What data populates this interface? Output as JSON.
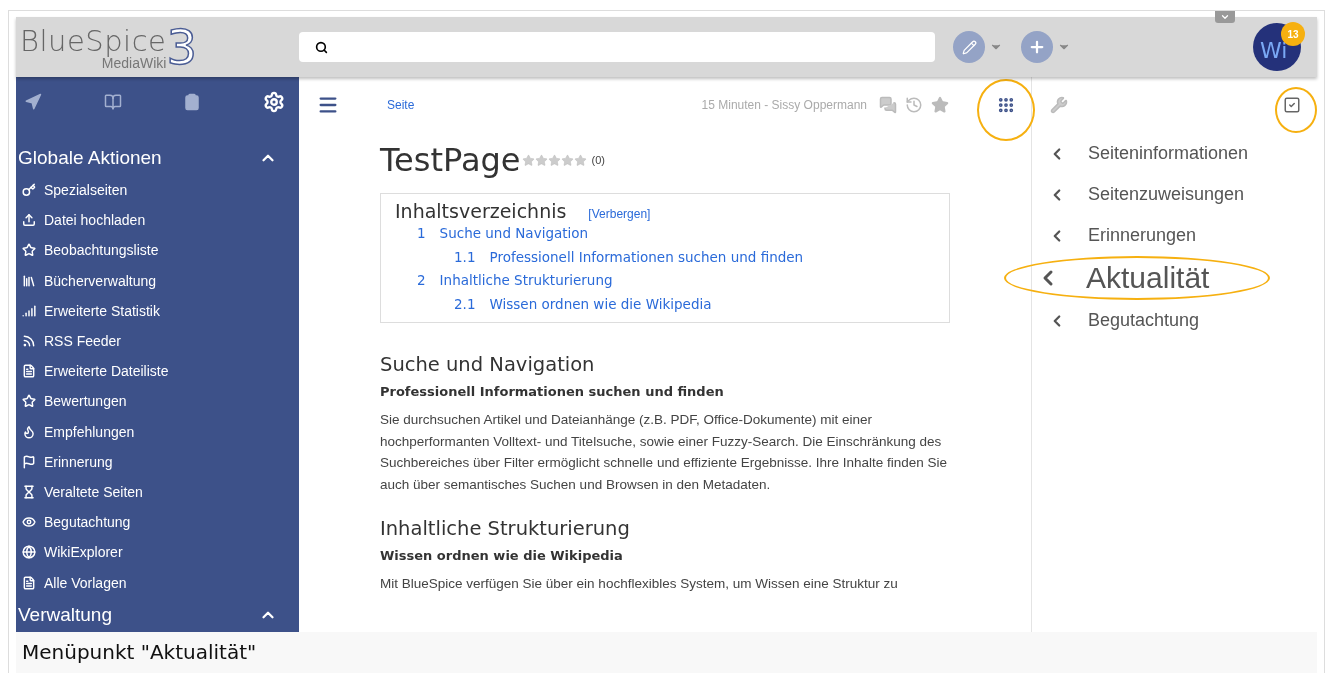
{
  "header": {
    "logo": {
      "name": "BlueSpice",
      "sub": "MediaWiki",
      "version": "3"
    },
    "avatar": {
      "initials": "Wi",
      "badge": "13"
    }
  },
  "sidebar": {
    "section": {
      "title": "Globale Aktionen",
      "expanded": true
    },
    "items": [
      "Spezialseiten",
      "Datei hochladen",
      "Beobachtungsliste",
      "Bücherverwaltung",
      "Erweiterte Statistik",
      "RSS Feeder",
      "Erweiterte Dateiliste",
      "Bewertungen",
      "Empfehlungen",
      "Erinnerung",
      "Veraltete Seiten",
      "Begutachtung",
      "WikiExplorer",
      "Alle Vorlagen"
    ],
    "next_section": {
      "title": "Verwaltung",
      "expanded": true
    }
  },
  "page": {
    "breadcrumb": "Seite",
    "last_edit": "15 Minuten - Sissy Oppermann",
    "title": "TestPage",
    "rating": {
      "stars": 0,
      "count": "(0)"
    },
    "toc": {
      "title": "Inhaltsverzeichnis",
      "toggle": "[Verbergen]",
      "items": [
        {
          "number": "1",
          "label": "Suche und Navigation",
          "children": [
            {
              "number": "1.1",
              "label": "Professionell Informationen suchen und finden"
            }
          ]
        },
        {
          "number": "2",
          "label": "Inhaltliche Strukturierung",
          "children": [
            {
              "number": "2.1",
              "label": "Wissen ordnen wie die Wikipedia"
            }
          ]
        }
      ]
    },
    "sections": [
      {
        "heading": "Suche und Navigation",
        "subheading": "Professionell Informationen suchen und finden",
        "text": "Sie durchsuchen Artikel und Dateianhänge (z.B. PDF, Office-Dokumente) mit einer hochperformanten Volltext- und Titelsuche, sowie einer Fuzzy-Search. Die Einschränkung des Suchbereiches über Filter ermöglicht schnelle und effiziente Ergebnisse. Ihre Inhalte finden Sie auch über semantisches Suchen und Browsen in den Metadaten."
      },
      {
        "heading": "Inhaltliche Strukturierung",
        "subheading": "Wissen ordnen wie die Wikipedia",
        "text": "Mit BlueSpice verfügen Sie über ein hochflexibles System, um Wissen eine Struktur zu"
      }
    ]
  },
  "tools_panel": {
    "items": [
      {
        "label": "Seiteninformationen",
        "highlighted": false
      },
      {
        "label": "Seitenzuweisungen",
        "highlighted": false
      },
      {
        "label": "Erinnerungen",
        "highlighted": false
      },
      {
        "label": "Aktualität",
        "highlighted": true
      },
      {
        "label": "Begutachtung",
        "highlighted": false
      }
    ]
  },
  "caption": "Menüpunkt \"Aktualität\""
}
